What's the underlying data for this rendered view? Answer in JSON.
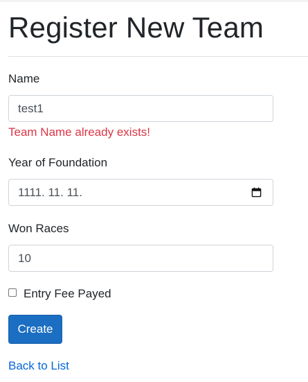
{
  "page": {
    "title": "Register New Team"
  },
  "form": {
    "name": {
      "label": "Name",
      "value": "test1",
      "error": "Team Name already exists!"
    },
    "year": {
      "label": "Year of Foundation",
      "value": "1111. 11. 11."
    },
    "won_races": {
      "label": "Won Races",
      "value": "10"
    },
    "entry_fee": {
      "label": "Entry Fee Payed",
      "checked": false
    },
    "submit_label": "Create"
  },
  "footer": {
    "back_link": "Back to List"
  },
  "icons": {
    "date_picker": "calendar-icon"
  },
  "colors": {
    "primary": "#1b6ec2",
    "error": "#dc3545",
    "link": "#0366d6"
  }
}
